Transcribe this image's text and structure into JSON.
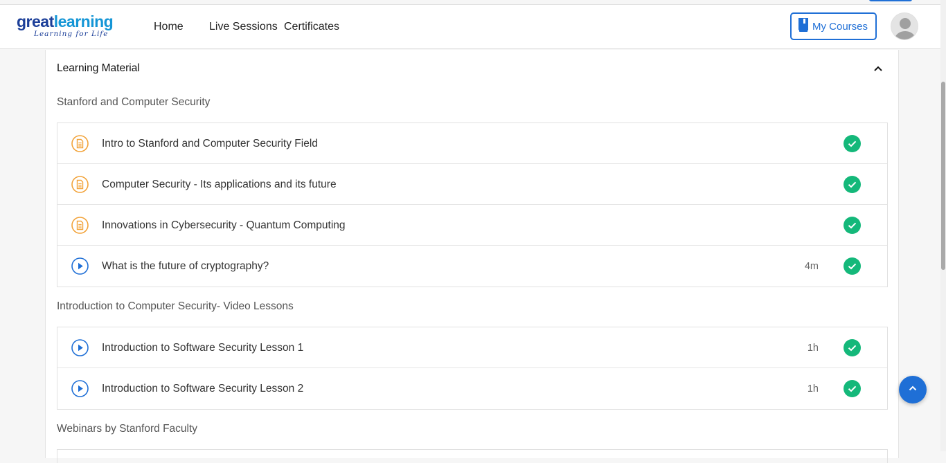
{
  "brand": {
    "name_part1": "great",
    "name_part2": "learning",
    "tagline": "Learning for Life"
  },
  "nav": {
    "home": "Home",
    "live_sessions": "Live Sessions",
    "certificates": "Certificates"
  },
  "header": {
    "my_courses_label": "My Courses"
  },
  "card": {
    "title": "Learning Material"
  },
  "sections": [
    {
      "title": "Stanford and Computer Security",
      "lessons": [
        {
          "type": "document",
          "title": "Intro to Stanford and Computer Security Field",
          "duration": "",
          "completed": true
        },
        {
          "type": "document",
          "title": "Computer Security - Its applications and its future",
          "duration": "",
          "completed": true
        },
        {
          "type": "document",
          "title": "Innovations in Cybersecurity - Quantum Computing",
          "duration": "",
          "completed": true
        },
        {
          "type": "video",
          "title": "What is the future of cryptography?",
          "duration": "4m",
          "completed": true
        }
      ]
    },
    {
      "title": "Introduction to Computer Security- Video Lessons",
      "lessons": [
        {
          "type": "video",
          "title": "Introduction to Software Security Lesson 1",
          "duration": "1h",
          "completed": true
        },
        {
          "type": "video",
          "title": "Introduction to Software Security Lesson 2",
          "duration": "1h",
          "completed": true
        }
      ]
    },
    {
      "title": "Webinars by Stanford Faculty",
      "lessons": []
    }
  ],
  "colors": {
    "brand_dark": "#1c3f99",
    "brand_light": "#1596d6",
    "accent": "#1f6fd6",
    "doc_icon": "#f2a33a",
    "complete": "#14b87a"
  },
  "icons": {
    "doc": "document-icon",
    "video": "play-circle-icon",
    "check": "check-circle-icon",
    "chevron": "chevron-up-icon",
    "book": "book-icon"
  }
}
